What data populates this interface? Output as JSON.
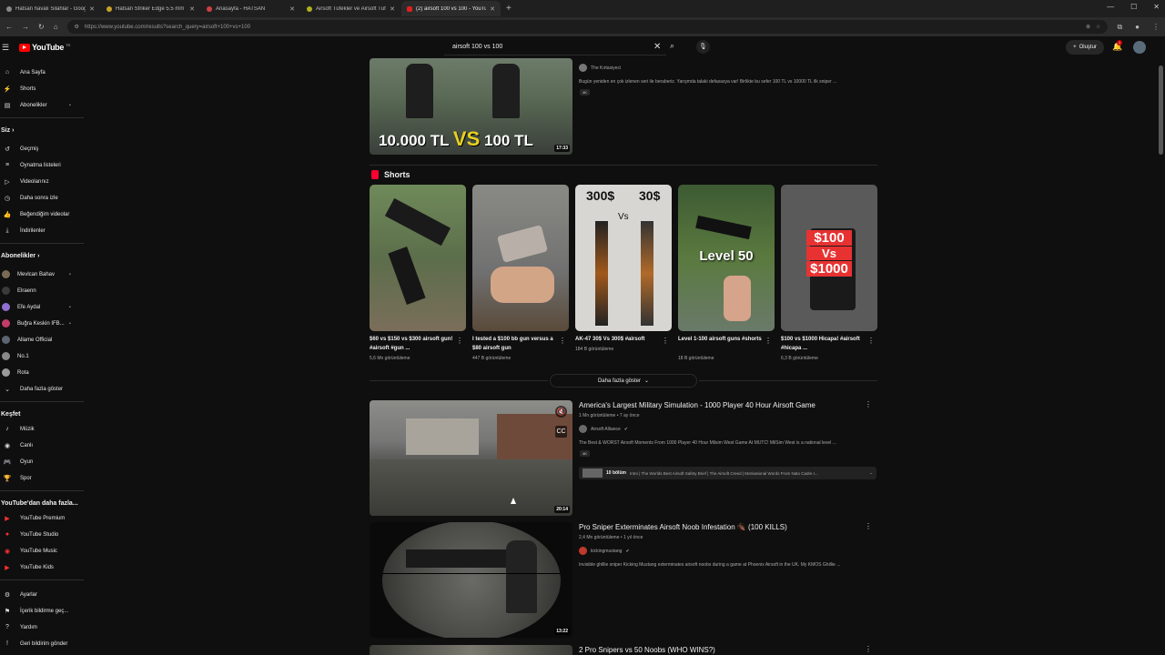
{
  "browser": {
    "tabs": [
      {
        "title": "Hatsan havalı Silahlar - Google"
      },
      {
        "title": "Hatsan Striker Edge 5.5 mm Ha"
      },
      {
        "title": "Anasayfa - HATSAN"
      },
      {
        "title": "Airsoft Tüfekler ve Airsoft Tüfe"
      },
      {
        "title": "(2) airsoft 100 vs 100 - YouTube"
      }
    ],
    "url": "https://www.youtube.com/results?search_query=airsoft+100+vs+100"
  },
  "header": {
    "logo_text": "YouTube",
    "logo_country": "TR",
    "search_query": "airsoft 100 vs 100",
    "create_label": "Oluştur",
    "notification_count": "1"
  },
  "sidebar": {
    "main": [
      {
        "label": "Ana Sayfa",
        "icon": "home-icon"
      },
      {
        "label": "Shorts",
        "icon": "shorts-icon"
      },
      {
        "label": "Abonelikler",
        "icon": "subscriptions-icon"
      }
    ],
    "you_heading": "Siz",
    "you": [
      {
        "label": "Geçmiş",
        "icon": "history-icon"
      },
      {
        "label": "Oynatma listeleri",
        "icon": "playlist-icon"
      },
      {
        "label": "Videolarınız",
        "icon": "your-videos-icon"
      },
      {
        "label": "Daha sonra izle",
        "icon": "clock-icon"
      },
      {
        "label": "Beğendiğim videolar",
        "icon": "like-icon"
      },
      {
        "label": "İndirilenler",
        "icon": "download-icon"
      }
    ],
    "subs_heading": "Abonelikler",
    "subs": [
      {
        "label": "Mevlcan Bahav",
        "color": "#7a6a55"
      },
      {
        "label": "Elraenn",
        "color": "#3a3a3a"
      },
      {
        "label": "Efe Aydal",
        "color": "#8f6fd0"
      },
      {
        "label": "Buğra Keskin IFB...",
        "color": "#c23b6a"
      },
      {
        "label": "Allame Official",
        "color": "#5b6470"
      },
      {
        "label": "No.1",
        "color": "#888888"
      },
      {
        "label": "Rota",
        "color": "#9a9a9a"
      }
    ],
    "show_more": "Daha fazla göster",
    "explore_heading": "Keşfet",
    "explore": [
      {
        "label": "Müzik",
        "icon": "music-icon"
      },
      {
        "label": "Canlı",
        "icon": "live-icon"
      },
      {
        "label": "Oyun",
        "icon": "gaming-icon"
      },
      {
        "label": "Spor",
        "icon": "trophy-icon"
      }
    ],
    "more_heading": "YouTube'dan daha fazla...",
    "more": [
      {
        "label": "YouTube Premium"
      },
      {
        "label": "YouTube Studio"
      },
      {
        "label": "YouTube Music"
      },
      {
        "label": "YouTube Kids"
      }
    ],
    "bottom": [
      {
        "label": "Ayarlar",
        "icon": "gear-icon"
      },
      {
        "label": "İçerik bildirme geç...",
        "icon": "flag-icon"
      },
      {
        "label": "Yardım",
        "icon": "help-icon"
      },
      {
        "label": "Geri bildirim gönder",
        "icon": "feedback-icon"
      }
    ]
  },
  "results": {
    "first": {
      "channel": "The Kırtasiyeci",
      "desc": "Bugün yeniden en çok izlenen seri ile beraberiz. Yarışmda talaki defasasya var! Birlikte bu sefer 100 TL vs 10000 TL ilk sniper ...",
      "chip": "4K",
      "thumb_text_left": "10.000 TL",
      "thumb_text_vs": "VS",
      "thumb_text_right": "100 TL",
      "duration": "17:33"
    },
    "shorts_heading": "Shorts",
    "shorts": [
      {
        "title": "$60 vs $150 vs $300 airsoft gun! #airsoft #gun ...",
        "views": "5,6 Mn görüntüleme"
      },
      {
        "title": "I tested a $100 bb gun versus a $80 airsoft gun",
        "views": "447 B görüntüleme"
      },
      {
        "title": "AK-47 30$ Vs 300$ #airsoft",
        "views": "184 B görüntüleme",
        "overlay_a": "300$",
        "overlay_b": "30$",
        "overlay_vs": "Vs"
      },
      {
        "title": "Level 1-100 airsoft guns #shorts",
        "views": "18 B görüntüleme",
        "overlay": "Level 50"
      },
      {
        "title": "$100 vs $1000 Hicapa! #airsoft #hicapa ...",
        "views": "6,3 B görüntüleme",
        "overlay_a": "$100",
        "overlay_vs": "Vs",
        "overlay_b": "$1000"
      }
    ],
    "show_more": "Daha fazla göster",
    "videos": [
      {
        "title": "America's Largest Military Simulation - 1000 Player 40 Hour Airsoft Game",
        "meta": "1 Mn görüntüleme • 7 ay önce",
        "channel": "Airsoft Alliance",
        "desc": "The Best & WORST Airsoft Moments From 1000 Player 40 Hour Milsim West Game At MUTC! MilSim West is a national level ...",
        "chip": "4K",
        "chapter_count": "10 bölüm",
        "chapter_text": "Intro | The Worlds Best Airsoft Safety Brief | The Airsoft Creed | Motivational Words From Nato Cadre I...",
        "duration": "20:14"
      },
      {
        "title": "Pro Sniper Exterminates Airsoft Noob Infestation 🪳 (100 KILLS)",
        "meta": "2,4 Mn görüntüleme • 1 yıl önce",
        "channel": "kickingmustang",
        "desc": "Invisible ghillie sniper Kicking Mustang exterminates airsoft noobs during a game at Phoenix Airsoft in the UK. My KMOS Ghillie ...",
        "duration": "13:22"
      },
      {
        "title": "2 Pro Snipers vs 50 Noobs (WHO WINS?)"
      }
    ]
  }
}
